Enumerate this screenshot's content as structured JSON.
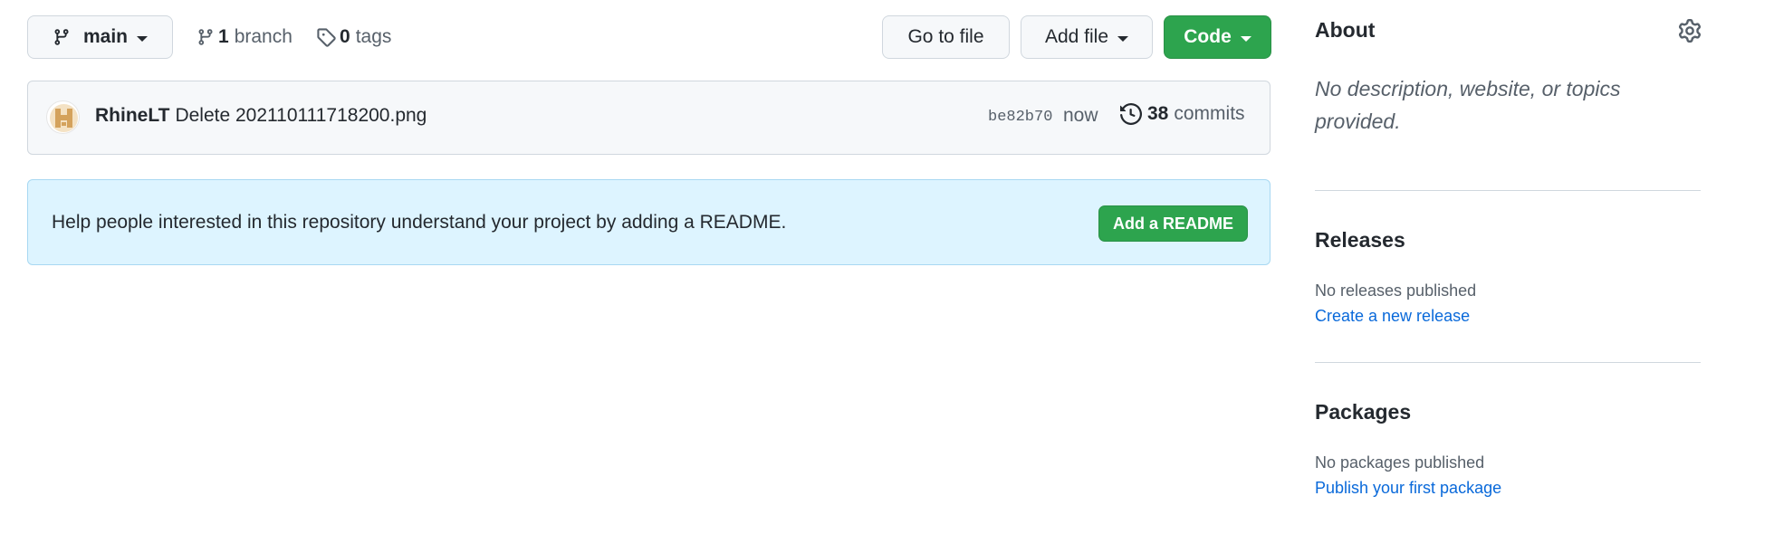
{
  "toolbar": {
    "branch_name": "main",
    "branch_count": "1",
    "branch_label": "branch",
    "tag_count": "0",
    "tag_label": "tags",
    "go_to_file": "Go to file",
    "add_file": "Add file",
    "code": "Code"
  },
  "commit": {
    "author": "RhineLT",
    "message": "Delete 202110111718200.png",
    "sha": "be82b70",
    "time": "now",
    "commit_count": "38",
    "commit_label": "commits"
  },
  "readme_banner": {
    "text": "Help people interested in this repository understand your project by adding a README.",
    "button_label": "Add a README"
  },
  "sidebar": {
    "about": {
      "title": "About",
      "description": "No description, website, or topics provided."
    },
    "releases": {
      "title": "Releases",
      "status": "No releases published",
      "link": "Create a new release"
    },
    "packages": {
      "title": "Packages",
      "status": "No packages published",
      "link": "Publish your first package"
    }
  },
  "colors": {
    "primary_green": "#2da44e",
    "info_bg": "#ddf4ff",
    "link_blue": "#0969da"
  },
  "icons": [
    "git-branch-icon",
    "tag-icon",
    "history-icon",
    "gear-icon",
    "caret-down-icon"
  ]
}
